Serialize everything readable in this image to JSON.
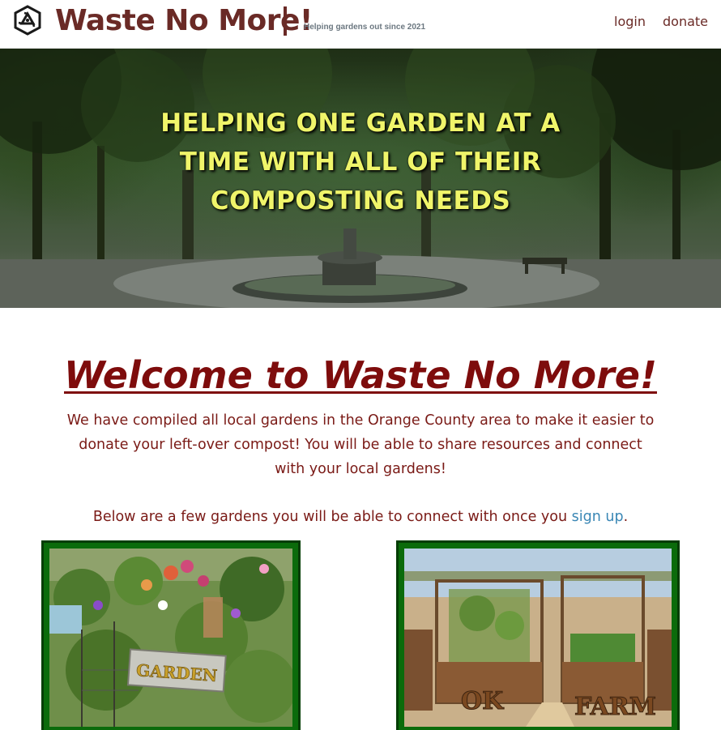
{
  "navbar": {
    "brand": "Waste No More!",
    "divider": "|",
    "tagline": "Helping gardens out since 2021",
    "logo_icon": "recycle-icon",
    "links": {
      "login": "login",
      "donate": "donate"
    }
  },
  "hero": {
    "title": "HELPING ONE GARDEN AT A TIME WITH ALL OF THEIR COMPOSTING NEEDS"
  },
  "main": {
    "welcome_heading": "Welcome to Waste No More!",
    "intro": "We have compiled all local gardens in the Orange County area to make it easier to donate your left-over compost! You will be able to share resources and connect with your local gardens!",
    "below_prefix": "Below are a few gardens you will be able to connect with once you ",
    "signup_link": "sign up",
    "below_suffix": "."
  },
  "gardens": [
    {
      "sign_text": "GARDEN"
    },
    {
      "sign_left": "OK",
      "sign_right": "FARM"
    }
  ],
  "colors": {
    "brand": "#6a2a26",
    "heading": "#7e0c0c",
    "hero_text": "#f0f56a",
    "link": "#3a87b5",
    "card_border": "#0b6b0b"
  }
}
